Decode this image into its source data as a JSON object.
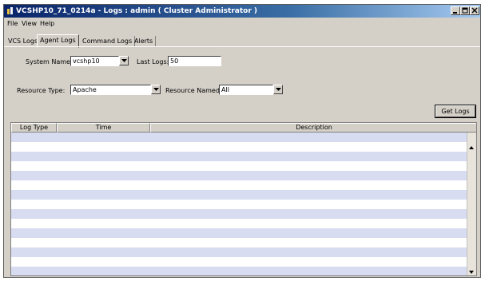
{
  "window": {
    "title": "VCSHP10_71_0214a - Logs : admin ( Cluster Administrator )"
  },
  "menu": [
    "File",
    "View",
    "Help"
  ],
  "tabs": [
    "VCS Logs",
    "Agent Logs",
    "Command Logs",
    "Alerts"
  ],
  "active_tab": "Agent Logs",
  "form": {
    "system_name_label": "System Name:",
    "system_name_value": "vcshp10",
    "last_logs_label": "Last Logs:",
    "last_logs_value": "50",
    "resource_type_label": "Resource Type:",
    "resource_type_value": "Apache",
    "resource_named_label": "Resource Named:",
    "resource_named_value": "All"
  },
  "get_logs_button": "Get Logs",
  "table": {
    "columns": [
      "Log Type",
      "Time",
      "Description"
    ],
    "rows": []
  }
}
